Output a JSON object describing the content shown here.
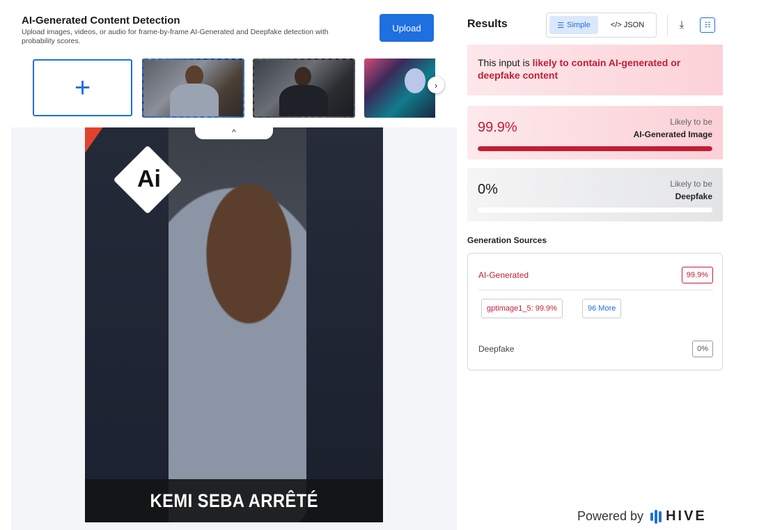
{
  "app": {
    "title": "AI-Generated Content Detection",
    "subtitle": "Upload images, videos, or audio for frame-by-frame AI-Generated and Deepfake detection with probability scores.",
    "upload_label": "Upload",
    "add_symbol": "+",
    "scroll_right_symbol": "›",
    "collapse_symbol": "^"
  },
  "preview": {
    "badge_text": "Ai",
    "caption": "KEMI SEBA ARRÊTÉ"
  },
  "results": {
    "title": "Results",
    "view_toggle": {
      "simple_label": "Simple",
      "json_label": "</> JSON",
      "selected": "Simple"
    },
    "download_icon": "⤓",
    "alert": {
      "prefix": "This input is ",
      "highlight": "likely to contain AI-generated or deepfake content"
    },
    "scores": [
      {
        "value": "99.9%",
        "likely_prefix": "Likely to be",
        "category": "AI-Generated Image",
        "fill": 0.999
      },
      {
        "value": "0%",
        "likely_prefix": "Likely to be",
        "category": "Deepfake",
        "fill": 0.0
      }
    ],
    "generation_sources": {
      "title": "Generation Sources",
      "ai_generated": {
        "label": "AI-Generated",
        "value": "99.9%"
      },
      "top_model": "gptimage1_5: 99.9%",
      "more_label": "96 More",
      "deepfake": {
        "label": "Deepfake",
        "value": "0%"
      }
    }
  },
  "footer": {
    "powered_by": "Powered by",
    "brand": "HIVE"
  },
  "colors": {
    "accent": "#1e6fe0",
    "danger": "#c41c34"
  }
}
